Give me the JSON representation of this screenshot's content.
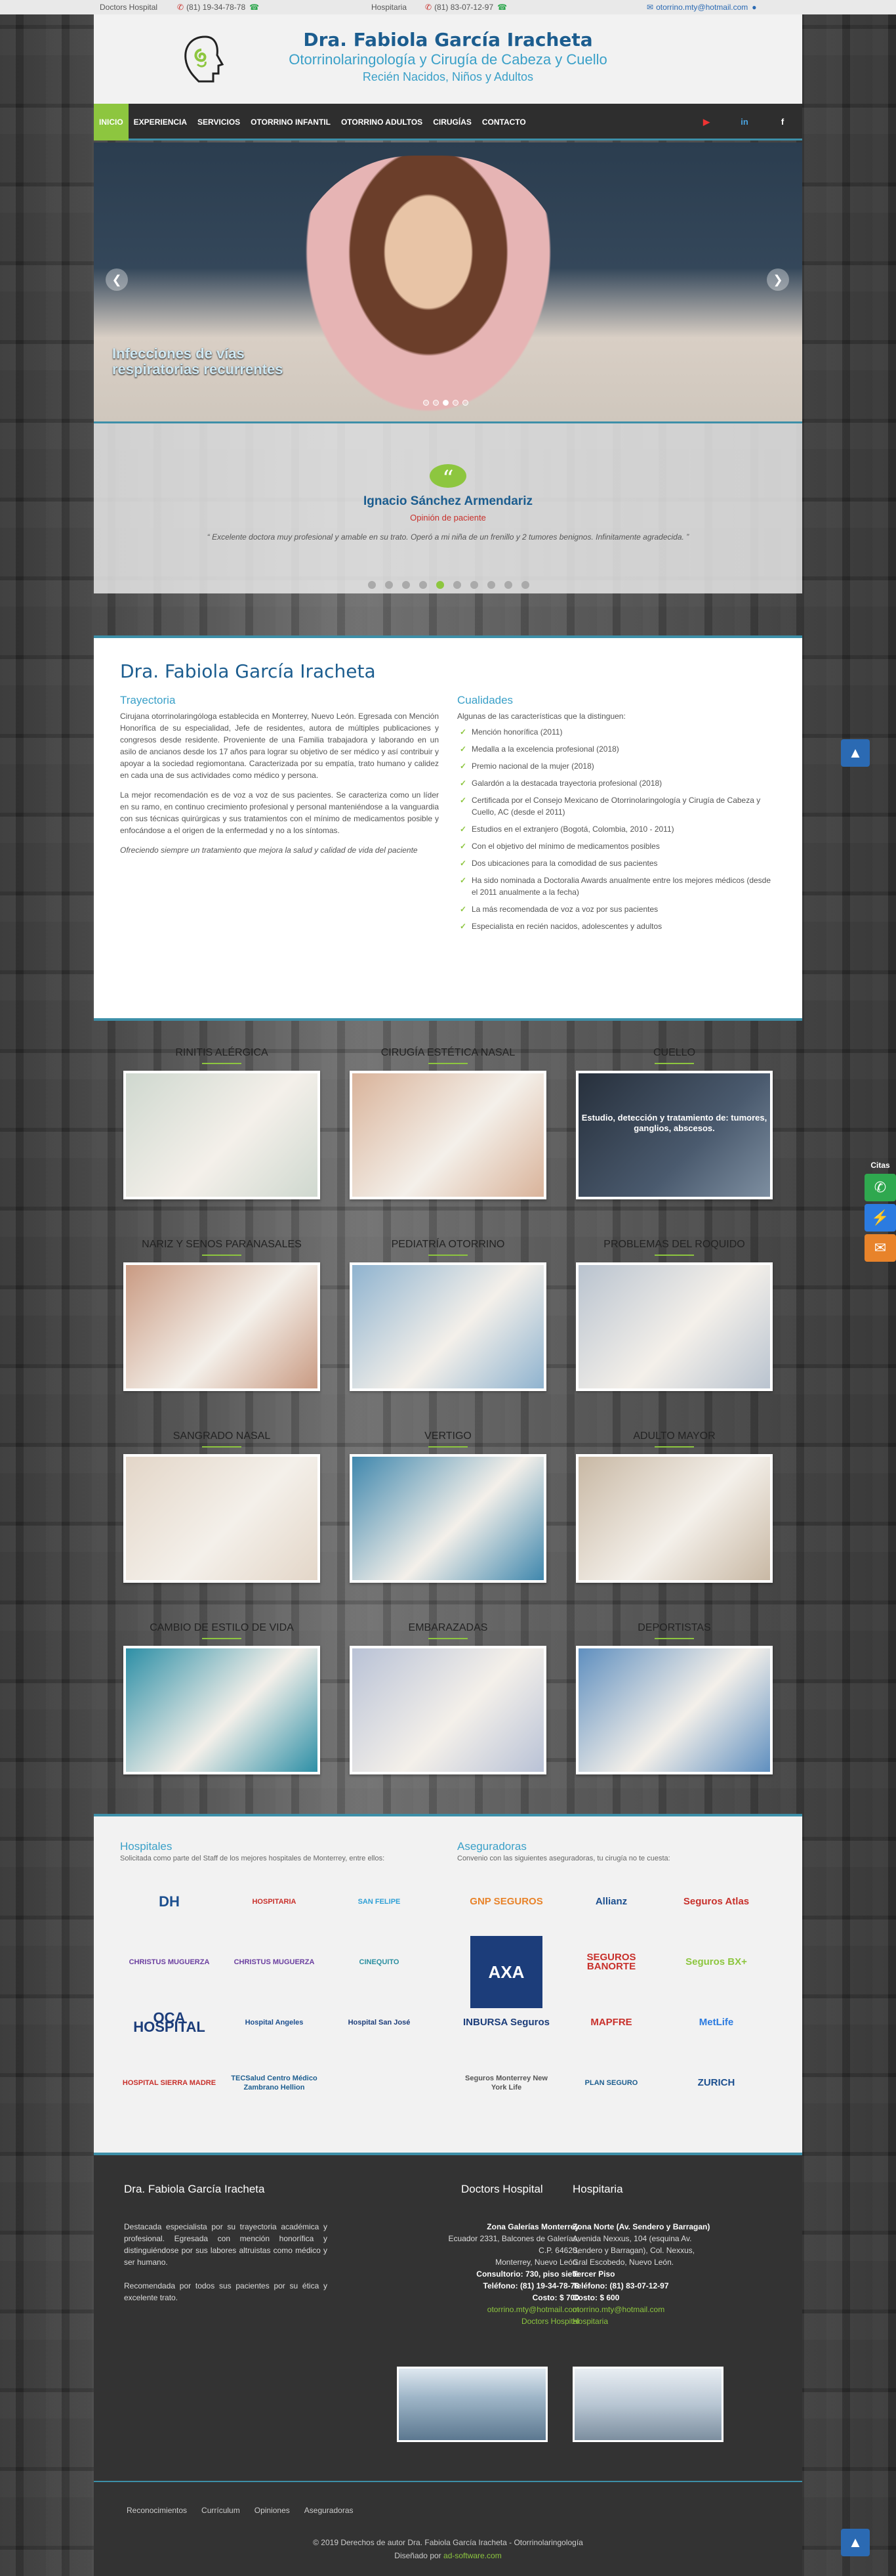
{
  "topbar": {
    "doctors_hospital": "Doctors Hospital",
    "phone1": "(81) 19-34-78-78",
    "hospitaria": "Hospitaria",
    "phone2": "(81) 83-07-12-97",
    "email": "otorrino.mty@hotmail.com"
  },
  "header": {
    "name": "Dra. Fabiola García Iracheta",
    "specialty": "Otorrinolaringología y Cirugía de Cabeza y Cuello",
    "patients": "Recién Nacidos, Niños y Adultos"
  },
  "nav": {
    "items": [
      "INICIO",
      "EXPERIENCIA",
      "SERVICIOS",
      "OTORRINO INFANTIL",
      "OTORRINO ADULTOS",
      "CIRUGÍAS",
      "CONTACTO"
    ],
    "active": "INICIO"
  },
  "slider": {
    "caption": "Infecciones de vías respiratorias recurrentes",
    "dots": 5,
    "active_dot": 2
  },
  "testimonial": {
    "name": "Ignacio Sánchez Armendariz",
    "role": "Opinión de paciente",
    "text": "Excelente doctora muy profesional y amable en su trato. Operó a mi niña de un frenillo y 2 tumores benignos. Infinitamente agradecida.",
    "dots": 10,
    "active_dot": 4
  },
  "about": {
    "title": "Dra. Fabiola García Iracheta",
    "trayectoria_heading": "Trayectoria",
    "p1": "Cirujana otorrinolaringóloga establecida en Monterrey, Nuevo León. Egresada con Mención Honorífica de su especialidad, Jefe de residentes, autora de múltiples publicaciones y congresos desde residente. Proveniente de una Familia trabajadora y laborando en un asilo de ancianos desde los 17 años para lograr su objetivo de ser médico y así contribuir y apoyar a la sociedad regiomontana. Caracterizada por su empatía, trato humano y calidez en cada una de sus actividades como médico y persona.",
    "p2": "La mejor recomendación es de voz a voz de sus pacientes. Se caracteriza como un líder en su ramo, en continuo crecimiento profesional y personal manteniéndose a la vanguardia con sus técnicas quirúrgicas y sus tratamientos con el mínimo de medicamentos posible y enfocándose a el origen de la enfermedad y no a los síntomas.",
    "p3": "Ofreciendo siempre un tratamiento que mejora la salud y calidad de vida del paciente",
    "cualidades_heading": "Cualidades",
    "cualidades_intro": "Algunas de las características que la distinguen:",
    "qualities": [
      "Mención honorífica (2011)",
      "Medalla a la excelencia profesional (2018)",
      "Premio nacional de la mujer (2018)",
      "Galardón a la destacada trayectoria profesional (2018)",
      "Certificada por el Consejo Mexicano de Otorrinolaringología y Cirugía de Cabeza y Cuello, AC (desde el 2011)",
      "Estudios en el extranjero (Bogotá, Colombia, 2010 - 2011)",
      "Con el objetivo del mínimo de medicamentos posibles",
      "Dos ubicaciones para la comodidad de sus pacientes",
      "Ha sido nominada a Doctoralia Awards anualmente entre los mejores médicos (desde el 2011 anualmente a la fecha)",
      "La más recomendada de voz a voz por sus pacientes",
      "Especialista en recién nacidos, adolescentes y adultos"
    ]
  },
  "services": [
    {
      "title": "RINITIS ALÉRGICA",
      "color": "#cfd8cf"
    },
    {
      "title": "CIRUGÍA ESTÉTICA NASAL",
      "color": "#d9b39a"
    },
    {
      "title": "CUELLO",
      "color": "#3d4a5c",
      "overlay": "Estudio, detección y tratamiento de: tumores, ganglios, abscesos."
    },
    {
      "title": "NARIZ Y SENOS PARANASALES",
      "color": "#c99a82"
    },
    {
      "title": "PEDIATRÍA OTORRINO",
      "color": "#8fb3cf"
    },
    {
      "title": "PROBLEMAS DEL ROQUIDO",
      "color": "#b9c3cf"
    },
    {
      "title": "SANGRADO NASAL",
      "color": "#e3d6c8"
    },
    {
      "title": "VERTIGO",
      "color": "#3f87ad"
    },
    {
      "title": "ADULTO MAYOR",
      "color": "#c8b8a4"
    },
    {
      "title": "CAMBIO DE ESTILO DE VIDA",
      "color": "#2d8fa6"
    },
    {
      "title": "EMBARAZADAS",
      "color": "#b9c2d6"
    },
    {
      "title": "DEPORTISTAS",
      "color": "#5f8fbf"
    }
  ],
  "partners": {
    "hosp_heading": "Hospitales",
    "hosp_sub": "Solicitada como parte del Staff de los mejores hospitales de Monterrey, entre ellos:",
    "aseg_heading": "Aseguradoras",
    "aseg_sub": "Convenio con las siguientes aseguradoras, tu cirugía no te cuesta:",
    "hospitals": [
      "DH",
      "HOSPITARIA",
      "SAN FELIPE",
      "CHRISTUS MUGUERZA",
      "CHRISTUS MUGUERZA",
      "CINEQUITO",
      "OCA HOSPITAL",
      "Hospital Angeles",
      "Hospital San José",
      "HOSPITAL SIERRA MADRE",
      "TECSalud Centro Médico Zambrano Hellion",
      ""
    ],
    "insurers": [
      "GNP SEGUROS",
      "Allianz",
      "Seguros Atlas",
      "AXA",
      "SEGUROS BANORTE",
      "Seguros BX+",
      "INBURSA Seguros",
      "MAPFRE",
      "MetLife",
      "Seguros Monterrey New York Life",
      "PLAN SEGURO",
      "ZURICH"
    ]
  },
  "footer": {
    "col1_title": "Dra. Fabiola García Iracheta",
    "col1_p1": "Destacada especialista por su trayectoria académica y profesional. Egresada con mención honorífica y distinguiéndose por sus labores altruistas como médico y ser humano.",
    "col1_p2": "Recomendada por todos sus pacientes por su ética y excelente trato.",
    "col2_title": "Doctors Hospital",
    "col2_lines": [
      "Zona Galerías Monterrey",
      "Ecuador 2331, Balcones de Galerías,",
      "C.P. 64620,",
      "Monterrey, Nuevo León.",
      "Consultorio: 730, piso siete",
      "Teléfono: (81) 19-34-78-78",
      "Costo: $ 700",
      "otorrino.mty@hotmail.com",
      "Doctors Hospital"
    ],
    "col3_title": "Hospitaria",
    "col3_lines": [
      "Zona Norte (Av. Sendero y Barragan)",
      "Avenida Nexxus, 104 (esquina Av. Sendero y Barragan), Col. Nexxus,",
      "Gral Escobedo, Nuevo León.",
      "Tercer Piso",
      "Teléfono: (81) 83-07-12-97",
      "Costo: $ 600",
      "otorrino.mty@hotmail.com",
      "Hospitaria"
    ],
    "nav": [
      "Reconocimientos",
      "Currículum",
      "Opiniones",
      "Aseguradoras"
    ],
    "copyright": "© 2019 Derechos de autor Dra. Fabiola García Iracheta - Otorrinolaringología",
    "designed": "Diseñado por",
    "designer": "ad-software.com"
  },
  "floating": {
    "cites_label": "Citas"
  }
}
